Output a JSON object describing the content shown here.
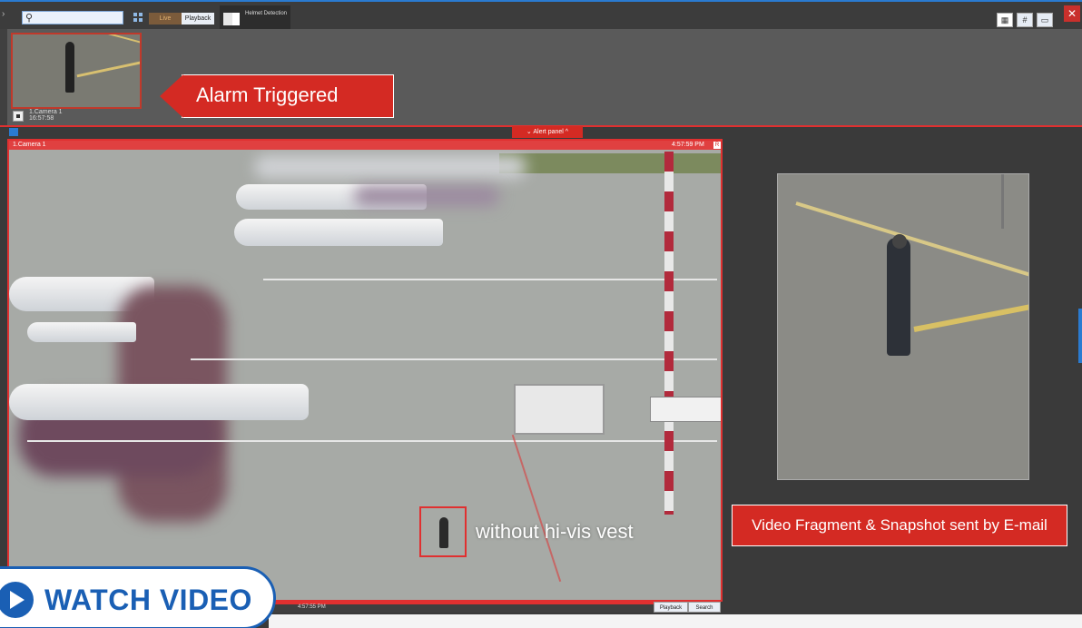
{
  "toolbar": {
    "mode_live": "Live",
    "mode_playback": "Playback",
    "layout_tab": "Helmet Detection"
  },
  "alert": {
    "camera": "1.Camera 1",
    "time": "16:57:58",
    "callout": "Alarm Triggered",
    "panel_label": "Alert panel"
  },
  "camera": {
    "name": "1.Camera 1",
    "time": "4:57:59 PM",
    "rec_badge": "R",
    "overlay_label": "without hi-vis vest",
    "timeline_time": "4:57:55 PM",
    "playback_btn": "Playback",
    "search_btn": "Search"
  },
  "right_panel": {
    "email_callout": "Video Fragment & Snapshot sent by E-mail"
  },
  "watch_video": "WATCH VIDEO",
  "colors": {
    "alarm_red": "#d42a23",
    "accent_blue": "#1a5fb4"
  }
}
